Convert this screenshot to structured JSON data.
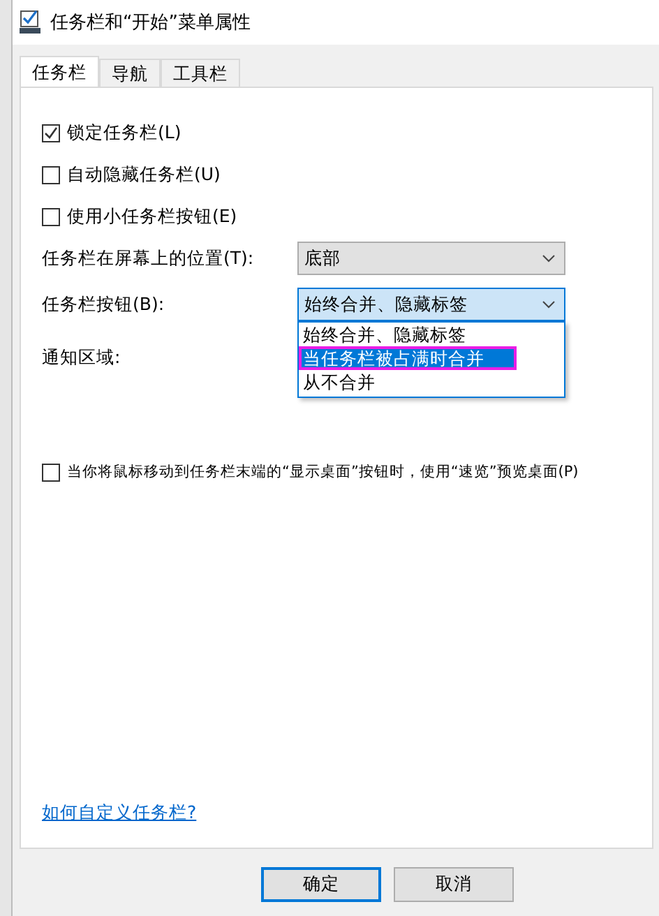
{
  "window": {
    "title": "任务栏和“开始”菜单属性"
  },
  "tabs": [
    {
      "label": "任务栏",
      "selected": true
    },
    {
      "label": "导航",
      "selected": false
    },
    {
      "label": "工具栏",
      "selected": false
    }
  ],
  "options": [
    {
      "label": "锁定任务栏(L)",
      "checked": true
    },
    {
      "label": "自动隐藏任务栏(U)",
      "checked": false
    },
    {
      "label": "使用小任务栏按钮(E)",
      "checked": false
    }
  ],
  "settings": [
    {
      "kind": "dropdown",
      "label": "任务栏在屏幕上的位置(T):",
      "value": "底部",
      "focused": false
    },
    {
      "kind": "dropdown",
      "label": "任务栏按钮(B):",
      "value": "始终合并、隐藏标签",
      "focused": true,
      "list": [
        {
          "label": "始终合并、隐藏标签",
          "highlighted": false,
          "outlined": false
        },
        {
          "label": "当任务栏被占满时合并",
          "highlighted": true,
          "outlined": true
        },
        {
          "label": "从不合并",
          "highlighted": false,
          "outlined": false
        }
      ]
    },
    {
      "kind": "label",
      "label": "通知区域:"
    }
  ],
  "peek_option": {
    "label": "当你将鼠标移动到任务栏末端的“显示桌面”按钮时，使用“速览”预览桌面(P)",
    "checked": false
  },
  "help_link": "如何自定义任务栏?",
  "buttons": [
    {
      "label": "确定",
      "default": true
    },
    {
      "label": "取消",
      "default": false
    }
  ]
}
